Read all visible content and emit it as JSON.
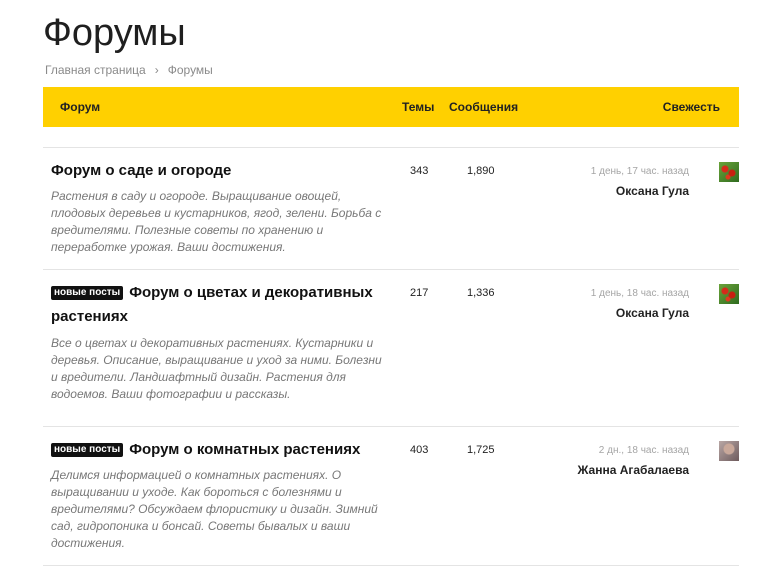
{
  "page": {
    "title": "Форумы"
  },
  "breadcrumb": {
    "home": "Главная страница",
    "separator": "›",
    "current": "Форумы"
  },
  "table_header": {
    "forum": "Форум",
    "topics": "Темы",
    "posts": "Сообщения",
    "freshness": "Свежесть"
  },
  "forums": [
    {
      "badge": "",
      "title": "Форум о саде и огороде",
      "description": "Растения в саду и огороде. Выращивание овощей, плодовых деревьев и кустарников, ягод, зелени. Борьба с вредителями. Полезные советы по хранению и переработке урожая. Ваши достижения.",
      "topics": "343",
      "posts": "1,890",
      "freshness": "1 день, 17 час. назад",
      "last_user": "Оксана Гула",
      "avatar": "berries-avatar"
    },
    {
      "badge": "новые посты",
      "title": "Форум о цветах и декоративных растениях",
      "description": "Все о цветах и декоративных растениях. Кустарники и деревья. Описание, выращивание и уход за ними. Болезни и вредители. Ландшафтный дизайн. Растения для водоемов. Ваши фотографии и рассказы.",
      "topics": "217",
      "posts": "1,336",
      "freshness": "1 день, 18 час. назад",
      "last_user": "Оксана Гула",
      "avatar": "berries-avatar"
    },
    {
      "badge": "новые посты",
      "title": "Форум о комнатных растениях",
      "description": "Делимся информацией о комнатных растениях. О выращивании и уходе. Как бороться с болезнями и вредителями? Обсуждаем флористику и дизайн. Зимний сад, гидропоника и бонсай. Советы бывалых и ваши достижения.",
      "topics": "403",
      "posts": "1,725",
      "freshness": "2 дн., 18 час. назад",
      "last_user": "Жанна Агабалаева",
      "avatar": "person-avatar"
    }
  ],
  "colors": {
    "header_bar": "#ffd000",
    "badge_bg": "#111111",
    "description_text": "#777777"
  }
}
